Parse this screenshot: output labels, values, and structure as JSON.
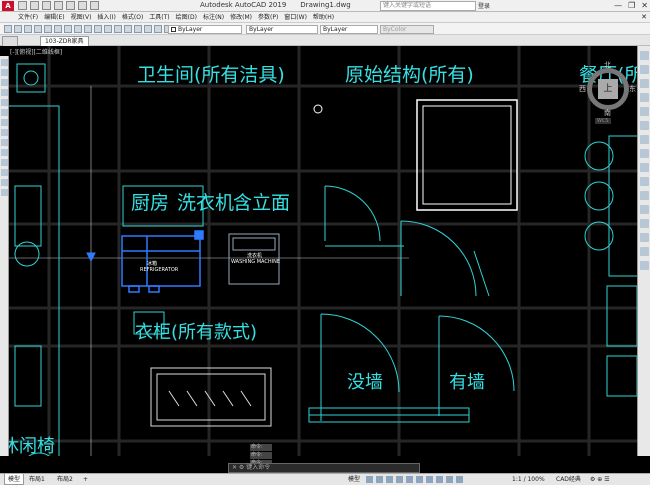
{
  "titlebar": {
    "app_logo": "A",
    "app": "Autodesk AutoCAD 2019",
    "document": "Drawing1.dwg",
    "search_placeholder": "键入关键字或短语",
    "login": "登录",
    "win_buttons": [
      "—",
      "❐",
      "✕"
    ]
  },
  "menu": {
    "items": [
      "文件(F)",
      "编辑(E)",
      "视图(V)",
      "插入(I)",
      "格式(O)",
      "工具(T)",
      "绘图(D)",
      "标注(N)",
      "修改(M)",
      "参数(P)",
      "窗口(W)",
      "帮助(H)"
    ],
    "close": "✕"
  },
  "toolbar": {
    "layer1": "ByLayer",
    "layer2": "ByLayer",
    "layer3": "ByLayer",
    "layer4": "ByColor"
  },
  "tabs": {
    "file": "103-ZDR家具"
  },
  "viewport_label": "[-][俯视][二维线框]",
  "drawing": {
    "labels": {
      "bathroom": "卫生间(所有洁具)",
      "structure": "原始结构(所有)",
      "dining": "餐厅(所",
      "kitchen": "厨房",
      "laundry": "洗衣机",
      "elevation": "含立面",
      "wardrobe": "衣柜(所有款式)",
      "no_wall": "没墙",
      "has_wall": "有墙",
      "leisure_chair": "休闲椅",
      "fridge_cn": "冰箱",
      "fridge_en": "REFRIGERATOR",
      "washer_cn": "洗衣机",
      "washer_en": "WASHING MACHINE"
    },
    "compass": {
      "north": "北",
      "south": "南",
      "east": "东",
      "west": "西",
      "top": "上",
      "wcs": "WCS"
    },
    "colors": {
      "label": "#35e0e3",
      "line": "#2fd3d6",
      "selected": "#2f7bff",
      "grid": "#262626"
    }
  },
  "command": {
    "history": [
      "命令:",
      "命令:",
      "命令:"
    ],
    "prompt": "✕ ⚙ 键入命令"
  },
  "layout_tabs": [
    "模型",
    "布局1",
    "布局2",
    "+"
  ],
  "status": {
    "model": "模型",
    "scale": "1:1 / 100%",
    "workspace": "CAD经典"
  }
}
